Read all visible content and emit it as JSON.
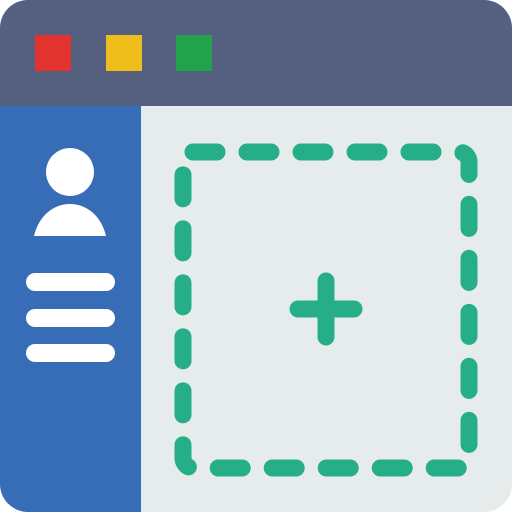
{
  "colors": {
    "titlebar": "#556080",
    "sidebar": "#366DB6",
    "main": "#E6ECEB",
    "red": "#E2332E",
    "yellow": "#EFBE1A",
    "green": "#22A24B",
    "sidebar_fg": "#FFFFFF",
    "accent": "#25AE88"
  },
  "titlebar": {
    "buttons": [
      {
        "name": "close",
        "color": "#E2332E"
      },
      {
        "name": "minimize",
        "color": "#EFBE1A"
      },
      {
        "name": "maximize",
        "color": "#22A24B"
      }
    ]
  },
  "sidebar": {
    "avatar_icon": "user-icon",
    "menu_lines": 3
  },
  "main": {
    "dropzone_icon": "plus-icon",
    "dropzone_style": "dashed"
  }
}
